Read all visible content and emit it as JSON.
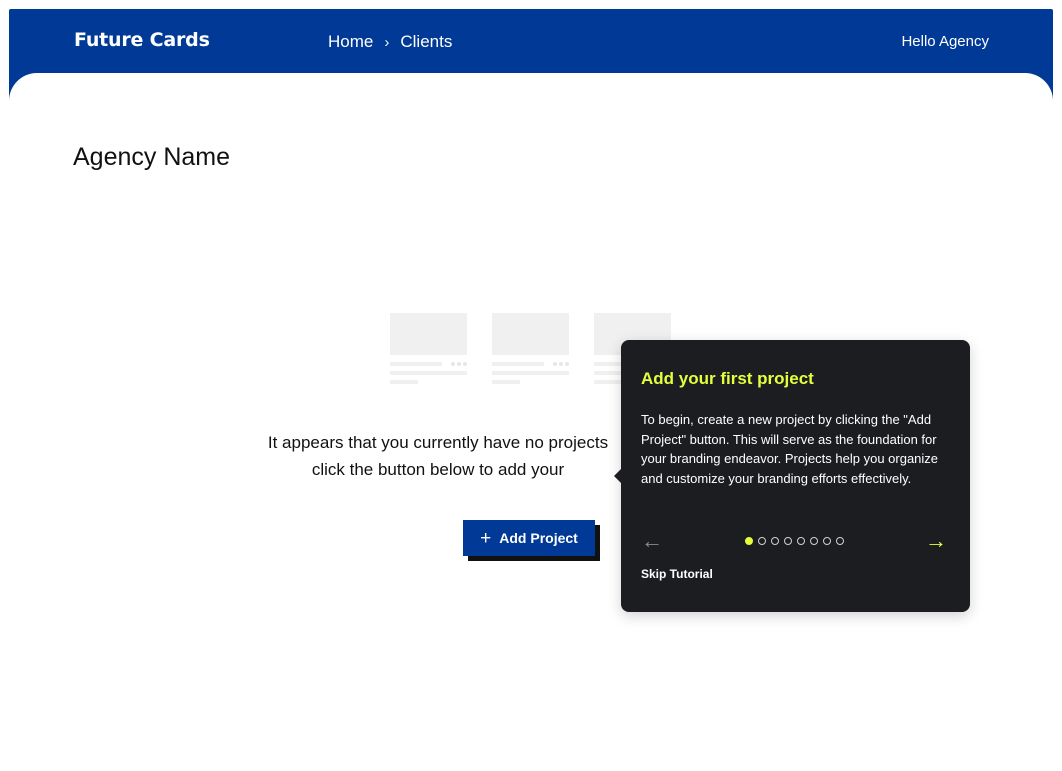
{
  "header": {
    "logo": "Future Cards",
    "breadcrumb": [
      {
        "label": "Home"
      },
      {
        "label": "Clients"
      }
    ],
    "breadcrumb_separator": "›",
    "greeting": "Hello Agency"
  },
  "main": {
    "title": "Agency Name",
    "empty_message": "It appears that you currently have no projects\nclick the button below to add your",
    "add_button": {
      "icon": "plus-icon",
      "label": "Add Project"
    }
  },
  "tutorial": {
    "title": "Add your first project",
    "body": "To begin, create a new project by clicking the \"Add Project\" button. This will serve as the foundation for your branding endeavor. Projects help you organize and customize your branding efforts effectively.",
    "step_current": 1,
    "step_total": 8,
    "prev_icon": "arrow-left-icon",
    "next_icon": "arrow-right-icon",
    "skip_label": "Skip Tutorial"
  },
  "colors": {
    "brand_blue": "#003a96",
    "tooltip_bg": "#1b1d20",
    "accent_lime": "#e4ff3b"
  }
}
